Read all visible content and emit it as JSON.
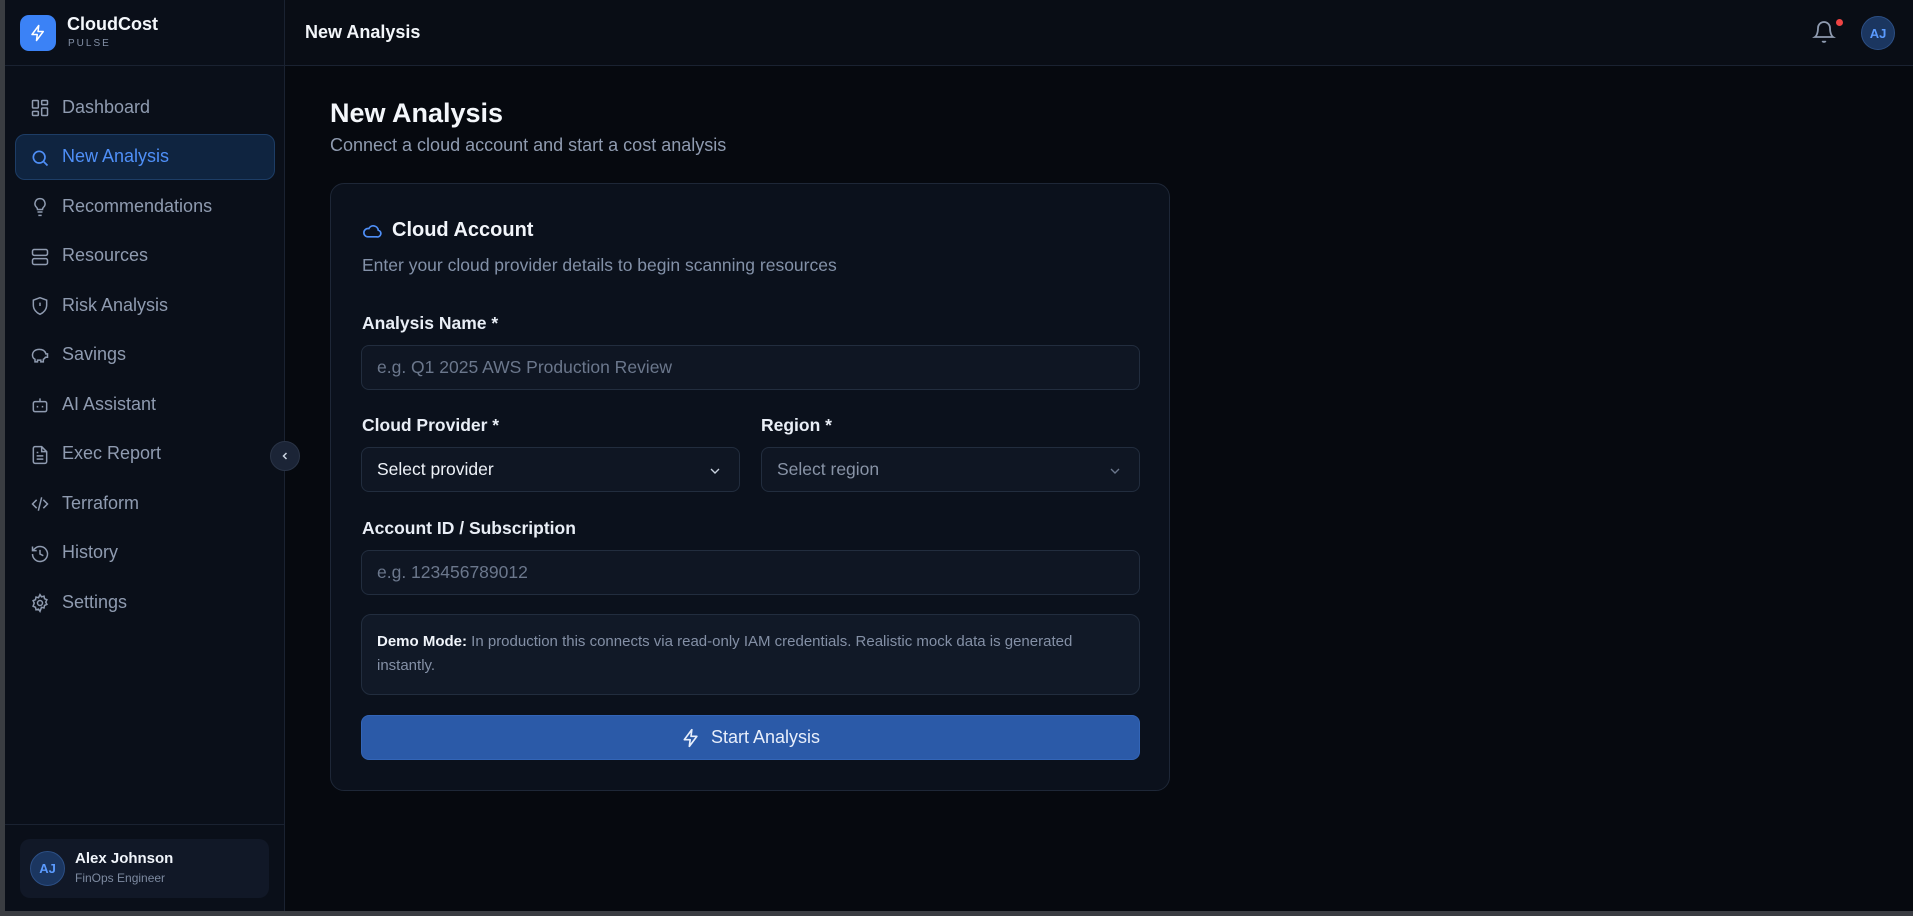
{
  "brand": {
    "name": "CloudCost",
    "subtitle": "PULSE"
  },
  "sidebar": {
    "items": [
      {
        "label": "Dashboard",
        "icon": "dashboard-icon",
        "active": false
      },
      {
        "label": "New Analysis",
        "icon": "search-icon",
        "active": true
      },
      {
        "label": "Recommendations",
        "icon": "lightbulb-icon",
        "active": false
      },
      {
        "label": "Resources",
        "icon": "server-icon",
        "active": false
      },
      {
        "label": "Risk Analysis",
        "icon": "shield-icon",
        "active": false
      },
      {
        "label": "Savings",
        "icon": "piggy-bank-icon",
        "active": false
      },
      {
        "label": "AI Assistant",
        "icon": "bot-icon",
        "active": false
      },
      {
        "label": "Exec Report",
        "icon": "file-text-icon",
        "active": false
      },
      {
        "label": "Terraform",
        "icon": "code-icon",
        "active": false
      },
      {
        "label": "History",
        "icon": "history-icon",
        "active": false
      },
      {
        "label": "Settings",
        "icon": "gear-icon",
        "active": false
      }
    ]
  },
  "user": {
    "initials": "AJ",
    "name": "Alex Johnson",
    "role": "FinOps Engineer"
  },
  "topbar": {
    "title": "New Analysis",
    "avatar_initials": "AJ",
    "has_notification": true
  },
  "page": {
    "title": "New Analysis",
    "subtitle": "Connect a cloud account and start a cost analysis"
  },
  "card": {
    "title": "Cloud Account",
    "description": "Enter your cloud provider details to begin scanning resources",
    "analysis_name": {
      "label": "Analysis Name *",
      "value": "",
      "placeholder": "e.g. Q1 2025 AWS Production Review"
    },
    "provider": {
      "label": "Cloud Provider *",
      "value": "Select provider"
    },
    "region": {
      "label": "Region *",
      "value": "Select region"
    },
    "account_id": {
      "label": "Account ID / Subscription",
      "value": "",
      "placeholder": "e.g. 123456789012"
    },
    "demo": {
      "title": "Demo Mode:",
      "text": "In production this connects via read-only IAM credentials. Realistic mock data is generated instantly."
    },
    "start_button": "Start Analysis"
  },
  "colors": {
    "accent": "#3b82f6",
    "button": "#2b5aa8",
    "background": "#06090f",
    "notification": "#ef4444"
  }
}
